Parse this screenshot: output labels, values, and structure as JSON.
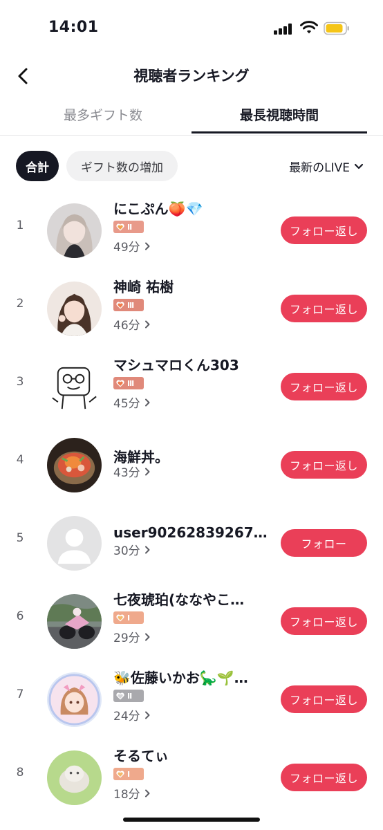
{
  "status_bar": {
    "time": "14:01"
  },
  "header": {
    "title": "視聴者ランキング"
  },
  "tabs": [
    {
      "label": "最多ギフト数"
    },
    {
      "label": "最長視聴時間"
    }
  ],
  "filters": {
    "chips": [
      {
        "label": "合計"
      },
      {
        "label": "ギフト数の増加"
      }
    ],
    "live_selector": "最新のLIVE"
  },
  "ranking": [
    {
      "rank": "1",
      "name": "にこぷん🍑💎",
      "badge_level": "II",
      "badge_color": "#e89a8a",
      "duration": "49分",
      "follow_label": "フォロー返し"
    },
    {
      "rank": "2",
      "name": "神崎 祐樹",
      "badge_level": "III",
      "badge_color": "#e0897a",
      "duration": "46分",
      "follow_label": "フォロー返し"
    },
    {
      "rank": "3",
      "name": "マシュマロくん303",
      "badge_level": "III",
      "badge_color": "#e0897a",
      "duration": "45分",
      "follow_label": "フォロー返し"
    },
    {
      "rank": "4",
      "name": "海鮮丼。",
      "badge_level": "",
      "badge_color": "",
      "duration": "43分",
      "follow_label": "フォロー返し"
    },
    {
      "rank": "5",
      "name": "user90262839267...",
      "badge_level": "",
      "badge_color": "",
      "duration": "30分",
      "follow_label": "フォロー"
    },
    {
      "rank": "6",
      "name": "七夜琥珀(ななやこ…",
      "badge_level": "I",
      "badge_color": "#efa98c",
      "duration": "29分",
      "follow_label": "フォロー返し"
    },
    {
      "rank": "7",
      "name": "🐝佐藤いかお🦕🌱…",
      "badge_level": "II",
      "badge_color": "#a9a9ad",
      "duration": "24分",
      "follow_label": "フォロー返し"
    },
    {
      "rank": "8",
      "name": "そるてぃ",
      "badge_level": "I",
      "badge_color": "#efa98c",
      "duration": "18分",
      "follow_label": "フォロー返し"
    }
  ]
}
